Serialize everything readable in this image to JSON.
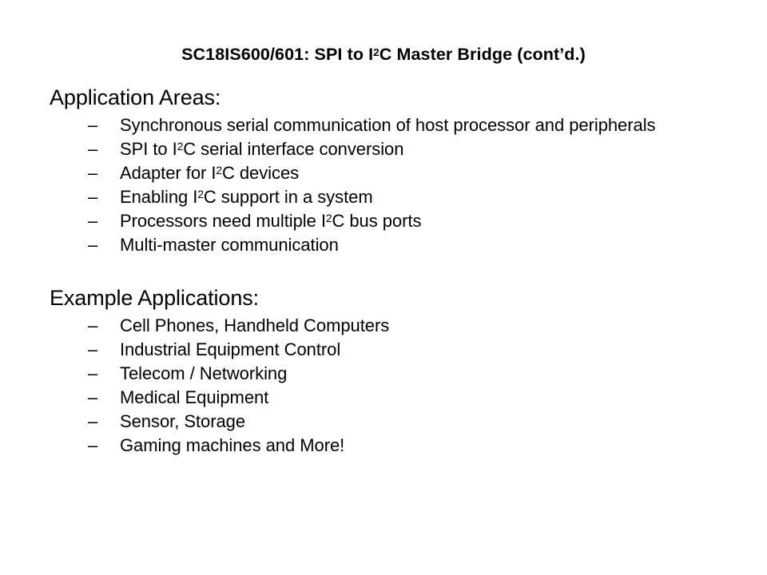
{
  "slide": {
    "background_color": "#ffffff",
    "text_color": "#000000",
    "title_prefix": "SC18IS600/601: SPI to I",
    "title_sup": "2",
    "title_suffix": "C Master Bridge (cont’d.)",
    "title_full": "SC18IS600/601: SPI to I2C Master Bridge (cont’d.)",
    "bullet_marker": "–"
  },
  "sections": [
    {
      "heading": "Application Areas:",
      "items": [
        {
          "pre": "Synchronous serial communication of host processor and peripherals",
          "sup": "",
          "post": "",
          "text": "Synchronous serial communication of host processor and peripherals"
        },
        {
          "pre": "SPI to I",
          "sup": "2",
          "post": "C serial interface conversion",
          "text": "SPI to I2C serial interface conversion"
        },
        {
          "pre": "Adapter for I",
          "sup": "2",
          "post": "C devices",
          "text": "Adapter for I2C devices"
        },
        {
          "pre": "Enabling I",
          "sup": "2",
          "post": "C support in a system",
          "text": "Enabling I2C support in a system"
        },
        {
          "pre": "Processors need multiple I",
          "sup": "2",
          "post": "C bus ports",
          "text": "Processors need multiple I2C bus ports"
        },
        {
          "pre": "Multi-master communication",
          "sup": "",
          "post": "",
          "text": "Multi-master communication"
        }
      ]
    },
    {
      "heading": "Example Applications:",
      "items": [
        {
          "pre": "Cell Phones, Handheld Computers",
          "sup": "",
          "post": "",
          "text": "Cell Phones, Handheld Computers"
        },
        {
          "pre": "Industrial Equipment Control",
          "sup": "",
          "post": "",
          "text": "Industrial Equipment Control"
        },
        {
          "pre": "Telecom / Networking",
          "sup": "",
          "post": "",
          "text": "Telecom / Networking"
        },
        {
          "pre": "Medical Equipment",
          "sup": "",
          "post": "",
          "text": "Medical Equipment"
        },
        {
          "pre": "Sensor, Storage",
          "sup": "",
          "post": "",
          "text": "Sensor, Storage"
        },
        {
          "pre": "Gaming machines and More!",
          "sup": "",
          "post": "",
          "text": "Gaming machines and More!"
        }
      ]
    }
  ]
}
